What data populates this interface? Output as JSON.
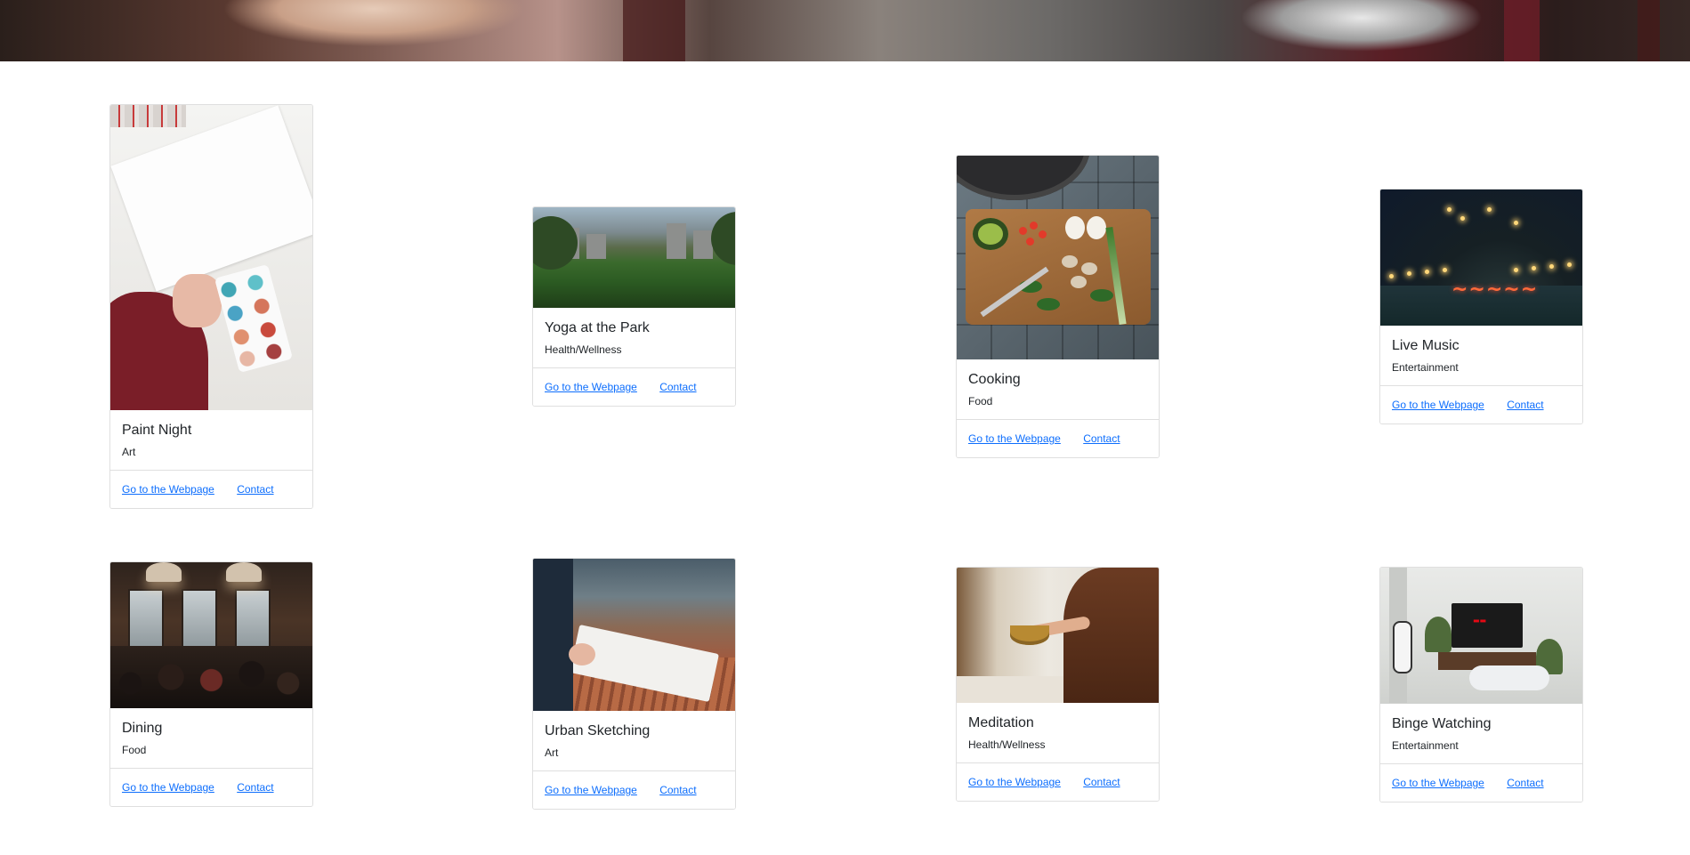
{
  "link_labels": {
    "webpage": "Go to the Webpage",
    "contact": "Contact"
  },
  "cards": [
    {
      "title": "Paint Night",
      "category": "Art",
      "image": "paint-night-photo"
    },
    {
      "title": "Yoga at the Park",
      "category": "Health/Wellness",
      "image": "yoga-park-photo"
    },
    {
      "title": "Cooking",
      "category": "Food",
      "image": "cooking-photo"
    },
    {
      "title": "Live Music",
      "category": "Entertainment",
      "image": "live-music-photo"
    },
    {
      "title": "Dining",
      "category": "Food",
      "image": "dining-photo"
    },
    {
      "title": "Urban Sketching",
      "category": "Art",
      "image": "urban-sketching-photo"
    },
    {
      "title": "Meditation",
      "category": "Health/Wellness",
      "image": "meditation-photo"
    },
    {
      "title": "Binge Watching",
      "category": "Entertainment",
      "image": "binge-watching-photo"
    }
  ],
  "colors": {
    "link": "#0d6efd",
    "text": "#212529",
    "border": "rgba(0,0,0,0.125)"
  }
}
